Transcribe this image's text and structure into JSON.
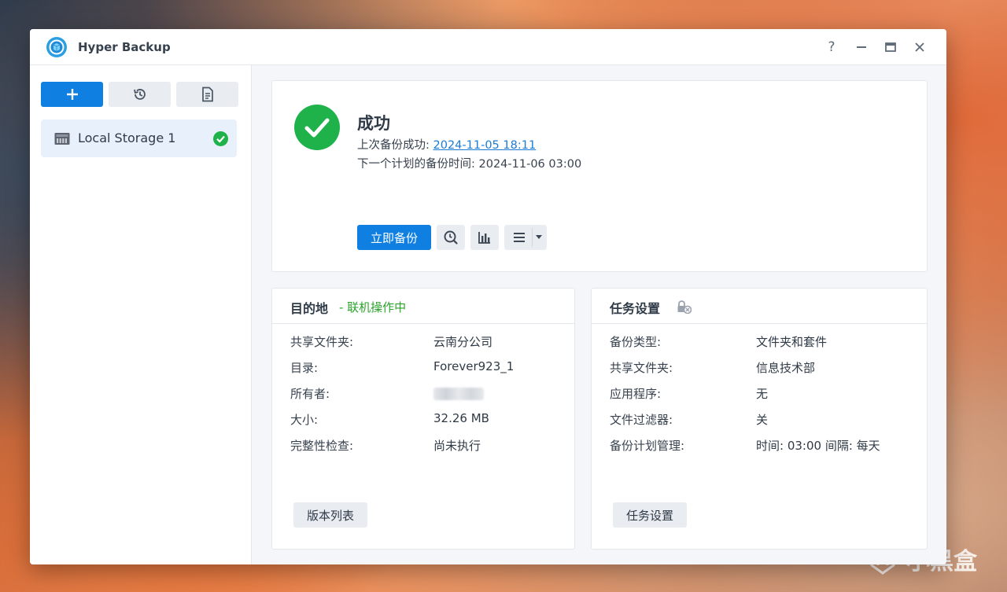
{
  "window": {
    "title": "Hyper Backup"
  },
  "titlebar_controls": {
    "help": "?"
  },
  "sidebar": {
    "items": [
      {
        "label": "Local Storage 1",
        "status": "success"
      }
    ]
  },
  "status": {
    "title": "成功",
    "last_backup_label": "上次备份成功:",
    "last_backup_time": "2024-11-05 18:11",
    "next_backup_label": "下一个计划的备份时间:",
    "next_backup_time": "2024-11-06 03:00",
    "backup_now_label": "立即备份"
  },
  "destination": {
    "title": "目的地",
    "status_text": "- 联机操作中",
    "rows": [
      {
        "label": "共享文件夹:",
        "value": "云南分公司"
      },
      {
        "label": "目录:",
        "value": "Forever923_1"
      },
      {
        "label": "所有者:",
        "value": ""
      },
      {
        "label": "大小:",
        "value": "32.26 MB"
      },
      {
        "label": "完整性检查:",
        "value": "尚未执行"
      }
    ],
    "footer_button": "版本列表"
  },
  "task_settings": {
    "title": "任务设置",
    "rows": [
      {
        "label": "备份类型:",
        "value": "文件夹和套件"
      },
      {
        "label": "共享文件夹:",
        "value": "信息技术部"
      },
      {
        "label": "应用程序:",
        "value": "无"
      },
      {
        "label": "文件过滤器:",
        "value": "关"
      },
      {
        "label": "备份计划管理:",
        "value": "时间: 03:00 间隔: 每天"
      }
    ],
    "footer_button": "任务设置"
  },
  "watermark": {
    "text": "小黑盒"
  },
  "colors": {
    "accent": "#0f7fe1",
    "success": "#1fb24a",
    "online": "#2ba42b",
    "link": "#1a7bd4"
  }
}
